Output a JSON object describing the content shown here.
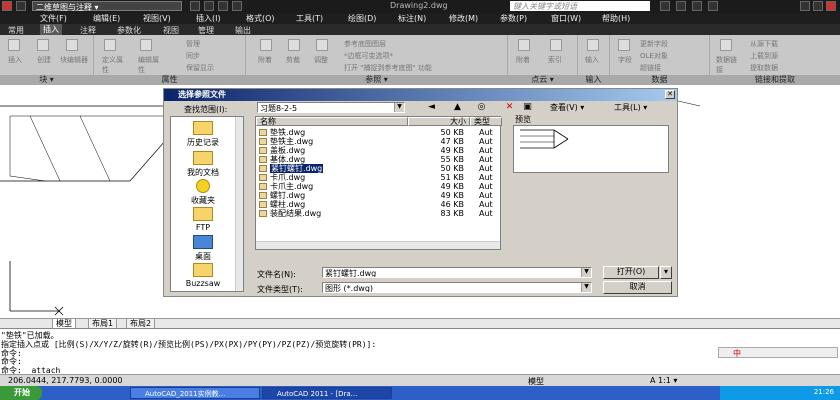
{
  "titlebar": {
    "workspace": "二维草图与注释",
    "filename": "Drawing2.dwg",
    "search_placeholder": "键入关键字或短语"
  },
  "menubar": {
    "items": [
      "文件(F)",
      "编辑(E)",
      "视图(V)",
      "插入(I)",
      "格式(O)",
      "工具(T)",
      "绘图(D)",
      "标注(N)",
      "修改(M)",
      "参数(P)",
      "窗口(W)",
      "帮助(H)"
    ]
  },
  "ribbon_tabs": {
    "items": [
      "常用",
      "插入",
      "注释",
      "参数化",
      "视图",
      "管理",
      "输出"
    ],
    "active": "插入"
  },
  "ribbon": {
    "block_panel": {
      "title": "块 ▾",
      "buttons": [
        "插入",
        "创建",
        "块编辑器"
      ]
    },
    "attr_panel": {
      "title": "属性",
      "buttons": [
        "定义属性",
        "编辑属性",
        "管理",
        "同步",
        "保留显示"
      ]
    },
    "ref_panel": {
      "title": "参照 ▾",
      "buttons": [
        "附着",
        "剪裁",
        "调整",
        "参考底图图层",
        "*边框可变选项*",
        "打开 \"捕捉到参考底图\" 功能"
      ]
    },
    "pointcloud_panel": {
      "title": "点云 ▾",
      "buttons": [
        "附着",
        "索引"
      ]
    },
    "import_panel": {
      "title": "输入",
      "buttons": [
        "输入"
      ]
    },
    "data_panel": {
      "title": "数据",
      "buttons": [
        "字段",
        "更新字段",
        "OLE对象",
        "超链接"
      ]
    },
    "link_panel": {
      "title": "链接和提取",
      "buttons": [
        "数据链接",
        "从源下载",
        "上载到源",
        "提取数据"
      ]
    }
  },
  "dialog": {
    "title": "选择参照文件",
    "lookin_label": "查找范围(I):",
    "lookin_value": "习题8-2-5",
    "view_label": "查看(V)",
    "tools_label": "工具(L)",
    "preview_label": "预览",
    "places": [
      "历史记录",
      "我的文档",
      "收藏夹",
      "FTP",
      "桌面",
      "Buzzsaw"
    ],
    "columns": [
      "名称",
      "大小",
      "类型"
    ],
    "files": [
      {
        "name": "垫铁.dwg",
        "size": "50 KB",
        "type": "Aut"
      },
      {
        "name": "垫铁主.dwg",
        "size": "47 KB",
        "type": "Aut"
      },
      {
        "name": "盖板.dwg",
        "size": "49 KB",
        "type": "Aut"
      },
      {
        "name": "基体.dwg",
        "size": "55 KB",
        "type": "Aut"
      },
      {
        "name": "紧钉螺钉.dwg",
        "size": "50 KB",
        "type": "Aut",
        "selected": true
      },
      {
        "name": "卡爪.dwg",
        "size": "51 KB",
        "type": "Aut"
      },
      {
        "name": "卡爪主.dwg",
        "size": "49 KB",
        "type": "Aut"
      },
      {
        "name": "螺钉.dwg",
        "size": "49 KB",
        "type": "Aut"
      },
      {
        "name": "螺柱.dwg",
        "size": "46 KB",
        "type": "Aut"
      },
      {
        "name": "装配结果.dwg",
        "size": "83 KB",
        "type": "Aut"
      }
    ],
    "filename_label": "文件名(N):",
    "filename_value": "紧钉螺钉.dwg",
    "filetype_label": "文件类型(T):",
    "filetype_value": "图形 (*.dwg)",
    "open_button": "打开(O)",
    "cancel_button": "取消"
  },
  "layout_tabs": [
    "模型",
    "布局1",
    "布局2"
  ],
  "command": {
    "lines": [
      "\"垫铁\"已加载。",
      "指定插入点或 [比例(S)/X/Y/Z/旋转(R)/预览比例(PS)/PX(PX)/PY(PY)/PZ(PZ)/预览旋转(PR)]:",
      "命令:",
      "命令:",
      "命令: _attach"
    ]
  },
  "statusbar": {
    "coords": "206.0444, 217.7793, 0.0000",
    "model_label": "模型",
    "scale": "A 1:1 ▾",
    "ime": "中"
  },
  "taskbar": {
    "start": "开始",
    "tasks": [
      "AutoCAD_2011实例教...",
      "AutoCAD 2011 - [Dra..."
    ],
    "clock": "21:26"
  },
  "colors": {
    "dialog_title_start": "#0a246a",
    "taskbar": "#2d5fc9",
    "selection": "#0a246a"
  }
}
